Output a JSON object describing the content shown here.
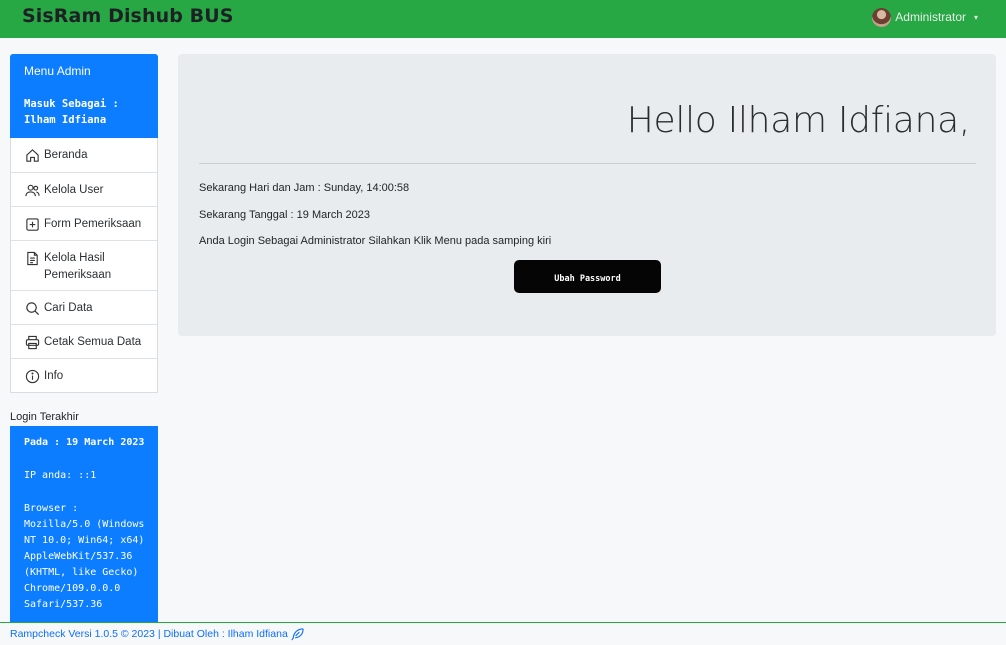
{
  "navbar": {
    "brand": "SisRam Dishub BUS",
    "user_label": "Administrator",
    "caret": "▾",
    "avatar_icon": "user-avatar"
  },
  "sidebar": {
    "title": "Menu Admin",
    "logged_as_label": "Masuk Sebagai :",
    "logged_as_name": "Ilham Idfiana",
    "items": [
      {
        "label": "Beranda",
        "icon": "house-icon"
      },
      {
        "label": "Kelola User",
        "icon": "users-icon"
      },
      {
        "label": "Form Pemeriksaan",
        "icon": "plus-square-icon"
      },
      {
        "label": "Kelola Hasil Pemeriksaan",
        "icon": "file-text-icon"
      },
      {
        "label": "Cari Data",
        "icon": "search-icon"
      },
      {
        "label": "Cetak Semua Data",
        "icon": "printer-icon"
      },
      {
        "label": "Info",
        "icon": "info-icon"
      }
    ]
  },
  "last_login": {
    "label": "Login Terakhir",
    "pada": "Pada : 19 March 2023",
    "ip": "IP anda: ::1",
    "browser_label": "Browser :",
    "browser_value": "Mozilla/5.0 (Windows NT 10.0; Win64; x64) AppleWebKit/537.36 (KHTML, like Gecko) Chrome/109.0.0.0 Safari/537.36"
  },
  "main": {
    "greeting": "Hello Ilham Idfiana,",
    "time_line": "Sekarang Hari dan Jam : Sunday, 14:00:58",
    "date_line": "Sekarang Tanggal : 19 March 2023",
    "info_line": "Anda Login Sebagai Administrator Silahkan Klik Menu pada samping kiri",
    "change_password_button": "Ubah Password"
  },
  "footer": {
    "text": "Rampcheck Versi 1.0.5 © 2023 | Dibuat Oleh : Ilham Idfiana",
    "icon": "feather-icon"
  },
  "colors": {
    "navbar": "#28a745",
    "primary": "#0d7dff",
    "panel": "#e9ecef",
    "button": "#050505"
  }
}
